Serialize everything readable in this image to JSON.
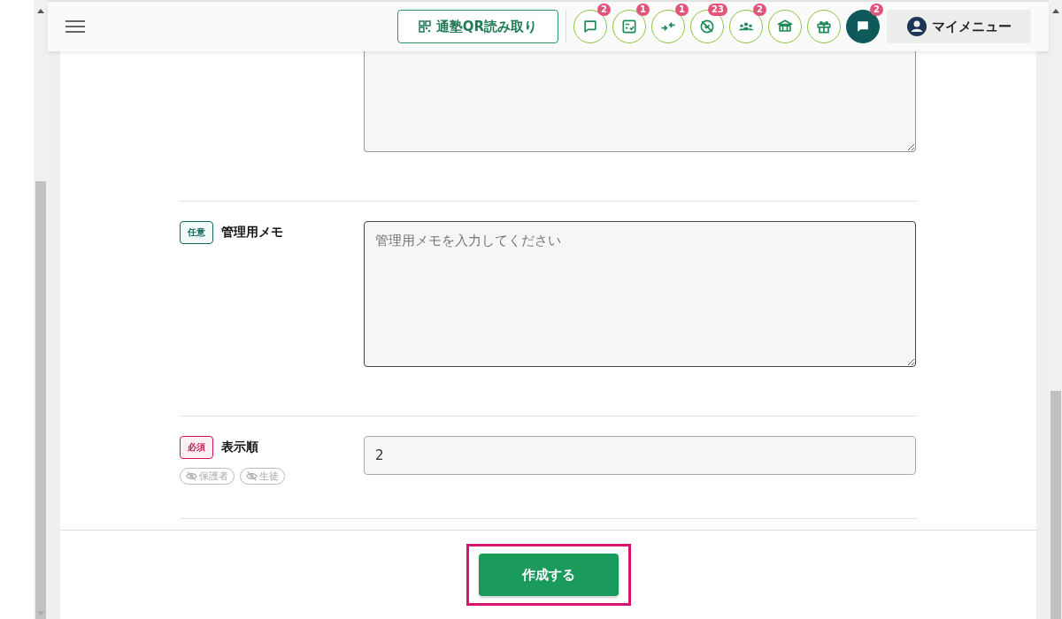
{
  "header": {
    "qr_button": "通塾QR読み取り",
    "icon_buttons": [
      {
        "kind": "chat",
        "badge": "2",
        "filled": false
      },
      {
        "kind": "checklist",
        "badge": "1",
        "filled": false
      },
      {
        "kind": "merge",
        "badge": "1",
        "filled": false
      },
      {
        "kind": "blocked",
        "badge": "23",
        "filled": false
      },
      {
        "kind": "group",
        "badge": "2",
        "filled": false
      },
      {
        "kind": "bank",
        "filled": false
      },
      {
        "kind": "gift",
        "filled": false
      },
      {
        "kind": "message",
        "badge": "2",
        "filled": true
      }
    ],
    "my_menu": "マイメニュー"
  },
  "form": {
    "rows": [
      {
        "kind": "textarea_partial"
      },
      {
        "kind": "textarea",
        "badge": {
          "kind": "optional",
          "text": "任意"
        },
        "label": "管理用メモ",
        "placeholder": "管理用メモを入力してください"
      },
      {
        "kind": "input",
        "badge": {
          "kind": "required",
          "text": "必須"
        },
        "label": "表示順",
        "value": "2",
        "visibility": [
          {
            "label": "保護者",
            "visible": false
          },
          {
            "label": "生徒",
            "visible": false
          }
        ]
      }
    ]
  },
  "submit_button": {
    "text": "作成する",
    "highlighted": true
  }
}
